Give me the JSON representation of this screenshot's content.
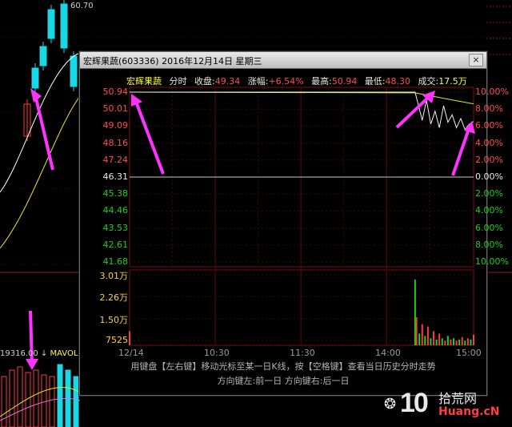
{
  "background": {
    "price_label": "60.70",
    "bottom_label": "19316.00",
    "mavol_label": "MAVOL",
    "colors": {
      "up": "#ff3b3b",
      "down": "#1ad7e6",
      "ma_white": "#ffffff",
      "ma_yellow": "#e6e61a",
      "ma_pink": "#e070e0"
    }
  },
  "popup": {
    "title": "宏辉果蔬(603336) 2016年12月14日 星期三",
    "close_label": "×",
    "info": {
      "name": "宏辉果蔬",
      "type": "分时",
      "close_label": "收盘:",
      "close_value": "49.34",
      "change_label": "涨幅:",
      "change_value": "+6.54%",
      "high_label": "最高:",
      "high_value": "50.94",
      "low_label": "最低:",
      "low_value": "48.30",
      "volume_label": "成交:",
      "volume_value": "17.5万"
    },
    "hint_line1": "用键盘【左右键】移动光标至某一日K线，按【空格键】查看当日历史分时走势",
    "hint_line2": "方向键左:前一日    方向键右:后一日"
  },
  "chart_data": {
    "type": "line",
    "title": "宏辉果蔬 分时",
    "x_axis_labels": [
      "12/14",
      "10:30",
      "11:30",
      "14:00",
      "15:00"
    ],
    "price_axis": [
      "50.94",
      "50.01",
      "49.09",
      "48.16",
      "47.24",
      "46.31",
      "45.38",
      "44.46",
      "43.53",
      "42.61",
      "41.68"
    ],
    "percent_axis": [
      "10.00%",
      "8.00%",
      "6.00%",
      "4.00%",
      "2.00%",
      "0.00%",
      "2.00%",
      "4.00%",
      "6.00%",
      "8.00%",
      "10.00%"
    ],
    "prev_close": 46.31,
    "volume_axis": [
      "3.01万",
      "2.26万",
      "1.50万",
      "7525"
    ],
    "price_series": {
      "x_minutes": [
        0,
        200,
        205,
        208,
        211,
        214,
        217,
        220,
        223,
        226,
        229,
        232,
        235,
        238,
        241
      ],
      "y": [
        50.94,
        50.94,
        49.4,
        50.5,
        49.2,
        49.9,
        49.0,
        50.2,
        49.3,
        49.7,
        49.0,
        49.5,
        48.9,
        49.2,
        49.34
      ],
      "note_first_segment": "price held at limit-up 50.94"
    },
    "avg_series": {
      "x_minutes": [
        0,
        200,
        220,
        241
      ],
      "y": [
        50.94,
        50.9,
        50.6,
        50.3
      ]
    },
    "volume_series": {
      "x_minutes": [
        0,
        200,
        201,
        203,
        205,
        207,
        209,
        211,
        213,
        215,
        217,
        219,
        221,
        223,
        225,
        227,
        229,
        231,
        233,
        235,
        237,
        239,
        241
      ],
      "values": [
        6000,
        28000,
        12000,
        5000,
        9000,
        4000,
        8000,
        3000,
        6000,
        2500,
        5000,
        3000,
        2000,
        4000,
        2500,
        3000,
        2000,
        2500,
        3500,
        2000,
        3000,
        2500,
        4500
      ]
    }
  },
  "watermark": {
    "logo": "10",
    "site_cn": "拾荒网",
    "url": "Huang.cN"
  }
}
